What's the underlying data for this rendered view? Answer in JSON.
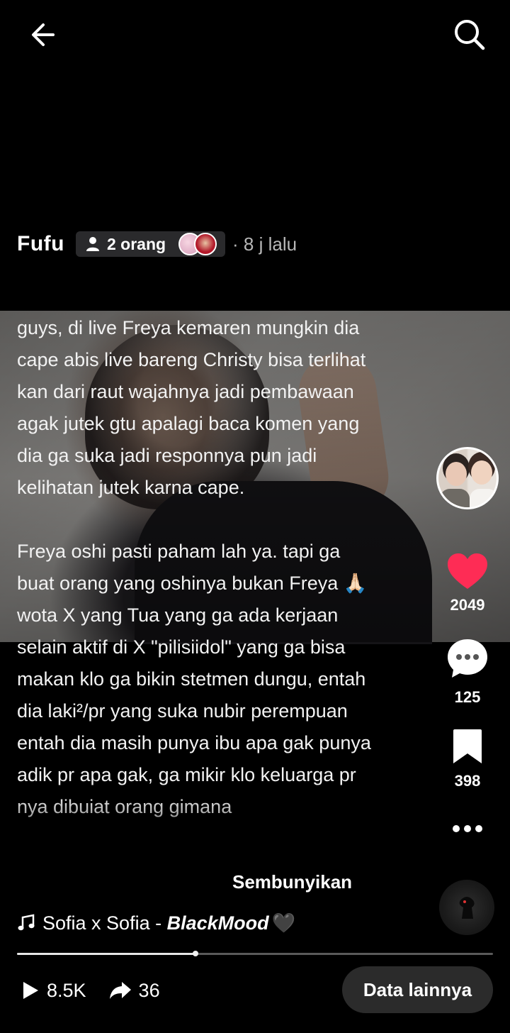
{
  "header": {
    "back_icon": "arrow-left-icon",
    "search_icon": "search-icon"
  },
  "author": {
    "name": "Fufu",
    "people_count": "2 orang",
    "time_ago": "· 8 j lalu"
  },
  "caption": {
    "paragraph1": "guys, di live Freya kemaren mungkin dia cape abis live bareng Christy bisa terlihat kan dari raut wajahnya jadi pembawaan agak jutek gtu apalagi baca komen yang dia ga suka jadi responnya pun jadi kelihatan jutek karna cape.",
    "paragraph2": "Freya oshi pasti paham lah ya. tapi ga buat orang yang oshinya bukan Freya 🙏🏻 wota X yang Tua yang ga ada kerjaan selain aktif di X \"pilisiidol\" yang ga bisa makan klo ga bikin stetmen dungu, entah dia laki²/pr yang suka nubir perempuan entah dia masih punya ibu apa gak punya adik pr apa gak, ga mikir klo keluarga pr nya dibuiat orang gimana",
    "hide_label": "Sembunyikan"
  },
  "rail": {
    "likes": "2049",
    "comments": "125",
    "saves": "398",
    "like_color": "#fe2c55"
  },
  "music": {
    "prefix": "Sofia x Sofia - ",
    "title": "BlackMood",
    "emoji": "🖤"
  },
  "progress": {
    "fraction": 0.375
  },
  "bottom": {
    "views": "8.5K",
    "shares": "36",
    "more_label": "Data lainnya"
  }
}
